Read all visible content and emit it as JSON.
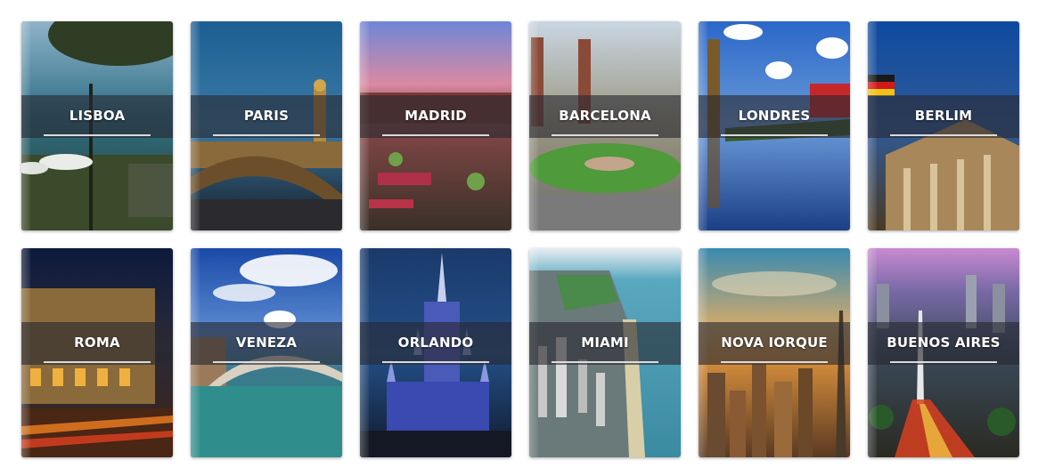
{
  "cities": [
    {
      "name": "LISBOA",
      "icon": "lisboa-photo"
    },
    {
      "name": "PARIS",
      "icon": "paris-photo"
    },
    {
      "name": "MADRID",
      "icon": "madrid-photo"
    },
    {
      "name": "BARCELONA",
      "icon": "barcelona-photo"
    },
    {
      "name": "LONDRES",
      "icon": "londres-photo"
    },
    {
      "name": "BERLIM",
      "icon": "berlim-photo"
    },
    {
      "name": "ROMA",
      "icon": "roma-photo"
    },
    {
      "name": "VENEZA",
      "icon": "veneza-photo"
    },
    {
      "name": "ORLANDO",
      "icon": "orlando-photo"
    },
    {
      "name": "MIAMI",
      "icon": "miami-photo"
    },
    {
      "name": "NOVA IORQUE",
      "icon": "nova-iorque-photo"
    },
    {
      "name": "BUENOS AIRES",
      "icon": "buenos-aires-photo"
    }
  ]
}
